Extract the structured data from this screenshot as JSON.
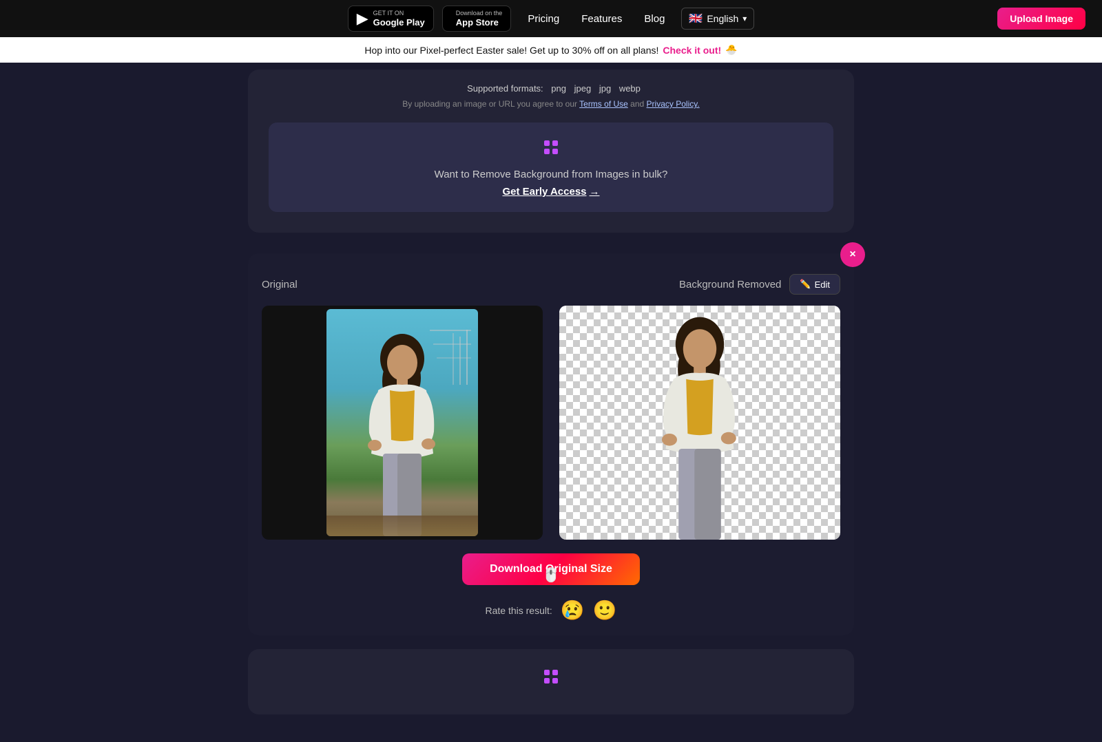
{
  "navbar": {
    "google_play_label_small": "GET IT ON",
    "google_play_label_large": "Google Play",
    "app_store_label_small": "Download on the",
    "app_store_label_large": "App Store",
    "nav_pricing": "Pricing",
    "nav_features": "Features",
    "nav_blog": "Blog",
    "language": "English",
    "upload_btn": "Upload Image"
  },
  "promo_banner": {
    "text": "Hop into our Pixel-perfect Easter sale! Get up to 30% off on all plans!",
    "link_text": "Check it out!",
    "emoji": "🐣"
  },
  "upload_card": {
    "supported_label": "Supported formats:",
    "formats": [
      "png",
      "jpeg",
      "jpg",
      "webp"
    ],
    "terms_text": "By uploading an image or URL you agree to our",
    "terms_link": "Terms of Use",
    "and_text": "and",
    "privacy_link": "Privacy Policy."
  },
  "bulk_promo": {
    "text": "Want to Remove Background from Images in bulk?",
    "link_text": "Get Early Access",
    "arrow": "→"
  },
  "result": {
    "original_label": "Original",
    "removed_label": "Background Removed",
    "edit_label": "Edit",
    "edit_icon": "✏️",
    "close_icon": "×",
    "download_btn": "Download Original Size"
  },
  "rate": {
    "label": "Rate this result:",
    "sad_emoji": "😢",
    "neutral_emoji": "🙂"
  },
  "bottom_bulk": {
    "icon": "✦"
  },
  "icons": {
    "google_play": "▶",
    "apple": "",
    "edit_pen": "✏",
    "chevron_down": "▾",
    "cross_purple": "✦"
  }
}
